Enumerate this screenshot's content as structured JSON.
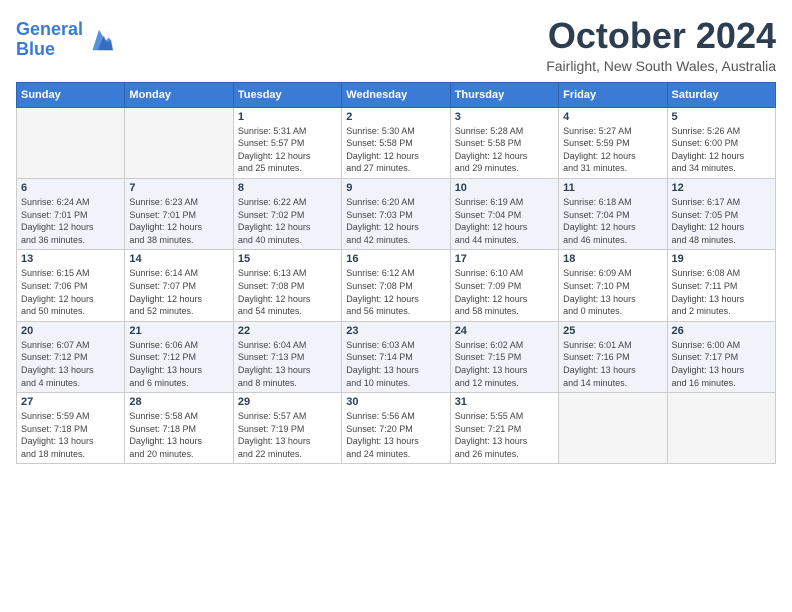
{
  "header": {
    "logo_line1": "General",
    "logo_line2": "Blue",
    "month": "October 2024",
    "location": "Fairlight, New South Wales, Australia"
  },
  "days_of_week": [
    "Sunday",
    "Monday",
    "Tuesday",
    "Wednesday",
    "Thursday",
    "Friday",
    "Saturday"
  ],
  "weeks": [
    [
      {
        "day": "",
        "info": ""
      },
      {
        "day": "",
        "info": ""
      },
      {
        "day": "1",
        "info": "Sunrise: 5:31 AM\nSunset: 5:57 PM\nDaylight: 12 hours\nand 25 minutes."
      },
      {
        "day": "2",
        "info": "Sunrise: 5:30 AM\nSunset: 5:58 PM\nDaylight: 12 hours\nand 27 minutes."
      },
      {
        "day": "3",
        "info": "Sunrise: 5:28 AM\nSunset: 5:58 PM\nDaylight: 12 hours\nand 29 minutes."
      },
      {
        "day": "4",
        "info": "Sunrise: 5:27 AM\nSunset: 5:59 PM\nDaylight: 12 hours\nand 31 minutes."
      },
      {
        "day": "5",
        "info": "Sunrise: 5:26 AM\nSunset: 6:00 PM\nDaylight: 12 hours\nand 34 minutes."
      }
    ],
    [
      {
        "day": "6",
        "info": "Sunrise: 6:24 AM\nSunset: 7:01 PM\nDaylight: 12 hours\nand 36 minutes."
      },
      {
        "day": "7",
        "info": "Sunrise: 6:23 AM\nSunset: 7:01 PM\nDaylight: 12 hours\nand 38 minutes."
      },
      {
        "day": "8",
        "info": "Sunrise: 6:22 AM\nSunset: 7:02 PM\nDaylight: 12 hours\nand 40 minutes."
      },
      {
        "day": "9",
        "info": "Sunrise: 6:20 AM\nSunset: 7:03 PM\nDaylight: 12 hours\nand 42 minutes."
      },
      {
        "day": "10",
        "info": "Sunrise: 6:19 AM\nSunset: 7:04 PM\nDaylight: 12 hours\nand 44 minutes."
      },
      {
        "day": "11",
        "info": "Sunrise: 6:18 AM\nSunset: 7:04 PM\nDaylight: 12 hours\nand 46 minutes."
      },
      {
        "day": "12",
        "info": "Sunrise: 6:17 AM\nSunset: 7:05 PM\nDaylight: 12 hours\nand 48 minutes."
      }
    ],
    [
      {
        "day": "13",
        "info": "Sunrise: 6:15 AM\nSunset: 7:06 PM\nDaylight: 12 hours\nand 50 minutes."
      },
      {
        "day": "14",
        "info": "Sunrise: 6:14 AM\nSunset: 7:07 PM\nDaylight: 12 hours\nand 52 minutes."
      },
      {
        "day": "15",
        "info": "Sunrise: 6:13 AM\nSunset: 7:08 PM\nDaylight: 12 hours\nand 54 minutes."
      },
      {
        "day": "16",
        "info": "Sunrise: 6:12 AM\nSunset: 7:08 PM\nDaylight: 12 hours\nand 56 minutes."
      },
      {
        "day": "17",
        "info": "Sunrise: 6:10 AM\nSunset: 7:09 PM\nDaylight: 12 hours\nand 58 minutes."
      },
      {
        "day": "18",
        "info": "Sunrise: 6:09 AM\nSunset: 7:10 PM\nDaylight: 13 hours\nand 0 minutes."
      },
      {
        "day": "19",
        "info": "Sunrise: 6:08 AM\nSunset: 7:11 PM\nDaylight: 13 hours\nand 2 minutes."
      }
    ],
    [
      {
        "day": "20",
        "info": "Sunrise: 6:07 AM\nSunset: 7:12 PM\nDaylight: 13 hours\nand 4 minutes."
      },
      {
        "day": "21",
        "info": "Sunrise: 6:06 AM\nSunset: 7:12 PM\nDaylight: 13 hours\nand 6 minutes."
      },
      {
        "day": "22",
        "info": "Sunrise: 6:04 AM\nSunset: 7:13 PM\nDaylight: 13 hours\nand 8 minutes."
      },
      {
        "day": "23",
        "info": "Sunrise: 6:03 AM\nSunset: 7:14 PM\nDaylight: 13 hours\nand 10 minutes."
      },
      {
        "day": "24",
        "info": "Sunrise: 6:02 AM\nSunset: 7:15 PM\nDaylight: 13 hours\nand 12 minutes."
      },
      {
        "day": "25",
        "info": "Sunrise: 6:01 AM\nSunset: 7:16 PM\nDaylight: 13 hours\nand 14 minutes."
      },
      {
        "day": "26",
        "info": "Sunrise: 6:00 AM\nSunset: 7:17 PM\nDaylight: 13 hours\nand 16 minutes."
      }
    ],
    [
      {
        "day": "27",
        "info": "Sunrise: 5:59 AM\nSunset: 7:18 PM\nDaylight: 13 hours\nand 18 minutes."
      },
      {
        "day": "28",
        "info": "Sunrise: 5:58 AM\nSunset: 7:18 PM\nDaylight: 13 hours\nand 20 minutes."
      },
      {
        "day": "29",
        "info": "Sunrise: 5:57 AM\nSunset: 7:19 PM\nDaylight: 13 hours\nand 22 minutes."
      },
      {
        "day": "30",
        "info": "Sunrise: 5:56 AM\nSunset: 7:20 PM\nDaylight: 13 hours\nand 24 minutes."
      },
      {
        "day": "31",
        "info": "Sunrise: 5:55 AM\nSunset: 7:21 PM\nDaylight: 13 hours\nand 26 minutes."
      },
      {
        "day": "",
        "info": ""
      },
      {
        "day": "",
        "info": ""
      }
    ]
  ]
}
